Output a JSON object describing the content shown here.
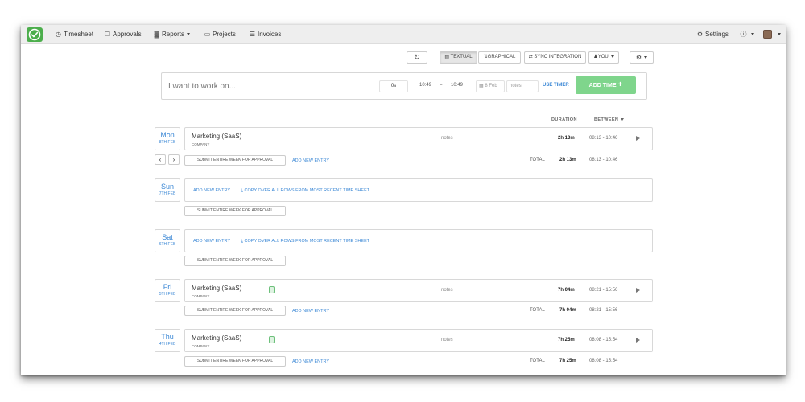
{
  "nav": {
    "items": [
      {
        "label": "Timesheet",
        "icon": "clock-icon",
        "glyph": "◷"
      },
      {
        "label": "Approvals",
        "icon": "inbox-icon",
        "glyph": "☐"
      },
      {
        "label": "Reports",
        "icon": "bar-chart-icon",
        "glyph": "▓"
      },
      {
        "label": "Projects",
        "icon": "folder-icon",
        "glyph": "▭"
      },
      {
        "label": "Invoices",
        "icon": "file-icon",
        "glyph": "☰"
      }
    ],
    "settings_label": "Settings",
    "settings_glyph": "⚙",
    "info_glyph": "ⓘ"
  },
  "toolbar": {
    "refresh_glyph": "↻",
    "textual_label": "Textual",
    "graphical_label": "Graphical",
    "sync_label": "Sync Integration",
    "you_label": "You",
    "gear_glyph": "⚙"
  },
  "entry_form": {
    "task_placeholder": "I want to work on...",
    "duration": "0s",
    "start_time": "10:49",
    "dash": "–",
    "end_time": "10:49",
    "date": "8 Feb",
    "notes_placeholder": "notes",
    "use_timer_label": "USE TIMER",
    "add_time_label": "ADD TIME"
  },
  "columns": {
    "duration_label": "DURATION",
    "between_label": "BETWEEN"
  },
  "days": [
    {
      "day": "Mon",
      "date": "8th Feb",
      "has_entry": true,
      "project": "Marketing (SaaS)",
      "client": "Company",
      "has_tag": false,
      "notes": "notes",
      "duration": "2h 13m",
      "between": "08:13  -  10:46",
      "submit_label": "Submit entire week for approval",
      "add_new_entry": "Add new entry",
      "total_label": "TOTAL",
      "total_duration": "2h 13m",
      "total_between": "08:13  -  10:46"
    },
    {
      "day": "Sun",
      "date": "7th Feb",
      "has_entry": false,
      "add_new_entry": "Add new entry",
      "copy_label": "⤓ Copy over all rows from most recent time sheet",
      "submit_label": "Submit entire week for approval"
    },
    {
      "day": "Sat",
      "date": "6th Feb",
      "has_entry": false,
      "add_new_entry": "Add new entry",
      "copy_label": "⤓ Copy over all rows from most recent time sheet",
      "submit_label": "Submit entire week for approval"
    },
    {
      "day": "Fri",
      "date": "5th Feb",
      "has_entry": true,
      "project": "Marketing (SaaS)",
      "client": "Company",
      "has_tag": true,
      "notes": "notes",
      "duration": "7h 04m",
      "between": "08:21  -  15:56",
      "submit_label": "Submit entire week for approval",
      "add_new_entry": "Add new entry",
      "total_label": "TOTAL",
      "total_duration": "7h 04m",
      "total_between": "08:21  -  15:56"
    },
    {
      "day": "Thu",
      "date": "4th Feb",
      "has_entry": true,
      "project": "Marketing (SaaS)",
      "client": "Company",
      "has_tag": true,
      "notes": "notes",
      "duration": "7h 25m",
      "between": "08:08  -  15:54",
      "submit_label": "Submit entire week for approval",
      "add_new_entry": "Add new entry",
      "total_label": "TOTAL",
      "total_duration": "7h 25m",
      "total_between": "08:08  -  15:54"
    }
  ],
  "week_nav": {
    "prev_glyph": "‹",
    "next_glyph": "›"
  },
  "colors": {
    "accent": "#3a87d5",
    "brand_green": "#4cae4c",
    "add_button": "#7fd58c"
  }
}
